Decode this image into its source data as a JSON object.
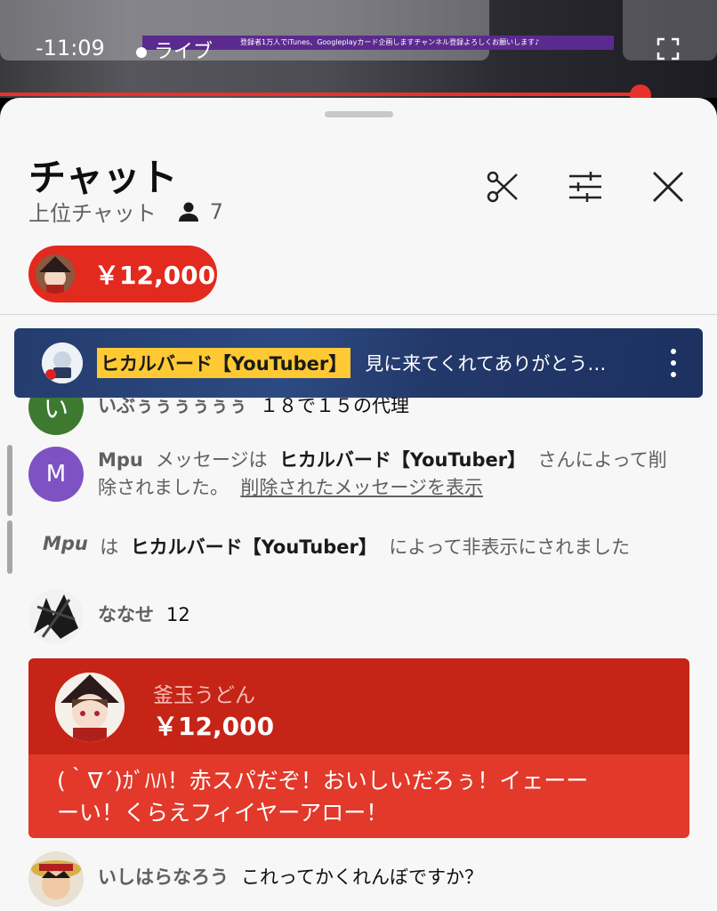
{
  "player": {
    "time_remaining": "-11:09",
    "live_label": "ライブ",
    "ticker_text": "登録者1万人でiTunes、Googleplayカード企画しますチャンネル登録よろしくお願いします♪"
  },
  "chat_header": {
    "title": "チャット",
    "mode": "上位チャット",
    "viewer_count": "7"
  },
  "pinned_superchat": {
    "amount": "￥12,000"
  },
  "banner": {
    "author": "ヒカルバード【YouTuber】",
    "text": "見に来てくれてありがとう…"
  },
  "messages": [
    {
      "avatar_letter": "い",
      "author": "いぶぅぅぅぅぅぅ",
      "text": "１８で１５の代理"
    },
    {
      "avatar_letter": "M",
      "author": "Mpu",
      "pre": "メッセージは",
      "by": "ヒカルバード【YouTuber】",
      "post1": "さんによって削",
      "post2": "除されました。",
      "link": "削除されたメッセージを表示"
    },
    {
      "user": "Mpu",
      "pre": "は",
      "by": "ヒカルバード【YouTuber】",
      "post": "によって非表示にされました"
    },
    {
      "author": "ななせ",
      "text": "12"
    }
  ],
  "superchat": {
    "author": "釜玉うどん",
    "amount": "￥12,000",
    "text_line1": "(｀∇´)ｶﾞﾊﾊ！赤スパだぞ！おいしいだろぅ！イェーー",
    "text_line2": "ーい！くらえフィイヤーアロー！"
  },
  "last_message": {
    "author": "いしはらなろう",
    "text": "これってかくれんぼですか？"
  },
  "colors": {
    "superchat_red": "#c52416",
    "superchat_body": "#e2392a",
    "banner_blue": "#243c6e",
    "author_highlight": "#ffc933",
    "progress_red": "#e8312b"
  }
}
